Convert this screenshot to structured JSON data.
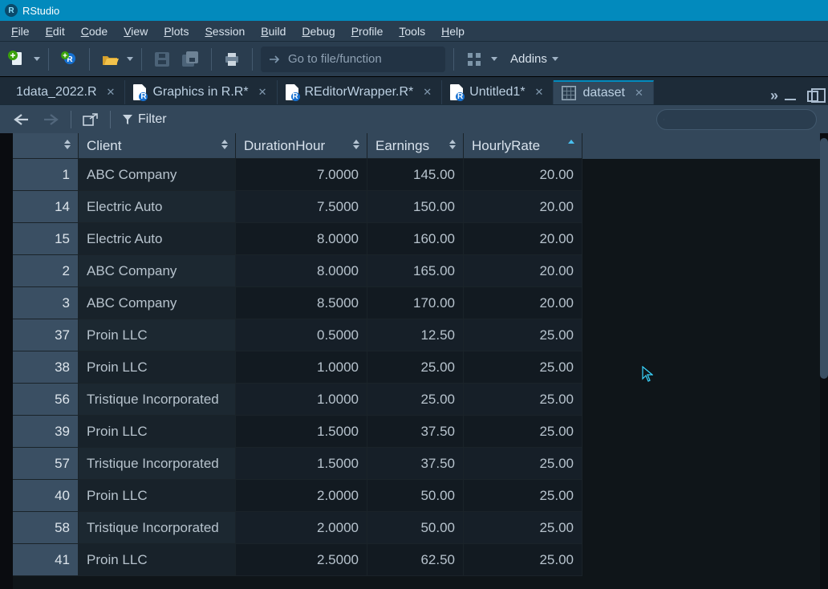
{
  "title": "RStudio",
  "menu": [
    "File",
    "Edit",
    "Code",
    "View",
    "Plots",
    "Session",
    "Build",
    "Debug",
    "Profile",
    "Tools",
    "Help"
  ],
  "goto_placeholder": "Go to file/function",
  "addins_label": "Addins",
  "tabs": [
    {
      "label": "1data_2022.R",
      "icon": "none",
      "dirty": false,
      "active": false
    },
    {
      "label": "Graphics in R.R*",
      "icon": "r",
      "dirty": true,
      "active": false
    },
    {
      "label": "REditorWrapper.R*",
      "icon": "r",
      "dirty": true,
      "active": false
    },
    {
      "label": "Untitled1*",
      "icon": "r",
      "dirty": true,
      "active": false
    },
    {
      "label": "dataset",
      "icon": "grid",
      "dirty": false,
      "active": true
    }
  ],
  "filter_label": "Filter",
  "search_placeholder": "",
  "columns": [
    {
      "key": "idx",
      "label": "",
      "sort": "both"
    },
    {
      "key": "Client",
      "label": "Client",
      "sort": "both"
    },
    {
      "key": "DurationHour",
      "label": "DurationHour",
      "sort": "both"
    },
    {
      "key": "Earnings",
      "label": "Earnings",
      "sort": "both"
    },
    {
      "key": "HourlyRate",
      "label": "HourlyRate",
      "sort": "asc"
    }
  ],
  "rows": [
    {
      "idx": "1",
      "Client": "ABC Company",
      "DurationHour": "7.0000",
      "Earnings": "145.00",
      "HourlyRate": "20.00"
    },
    {
      "idx": "14",
      "Client": "Electric Auto",
      "DurationHour": "7.5000",
      "Earnings": "150.00",
      "HourlyRate": "20.00"
    },
    {
      "idx": "15",
      "Client": "Electric Auto",
      "DurationHour": "8.0000",
      "Earnings": "160.00",
      "HourlyRate": "20.00"
    },
    {
      "idx": "2",
      "Client": "ABC Company",
      "DurationHour": "8.0000",
      "Earnings": "165.00",
      "HourlyRate": "20.00"
    },
    {
      "idx": "3",
      "Client": "ABC Company",
      "DurationHour": "8.5000",
      "Earnings": "170.00",
      "HourlyRate": "20.00"
    },
    {
      "idx": "37",
      "Client": "Proin LLC",
      "DurationHour": "0.5000",
      "Earnings": "12.50",
      "HourlyRate": "25.00"
    },
    {
      "idx": "38",
      "Client": "Proin LLC",
      "DurationHour": "1.0000",
      "Earnings": "25.00",
      "HourlyRate": "25.00"
    },
    {
      "idx": "56",
      "Client": "Tristique Incorporated",
      "DurationHour": "1.0000",
      "Earnings": "25.00",
      "HourlyRate": "25.00"
    },
    {
      "idx": "39",
      "Client": "Proin LLC",
      "DurationHour": "1.5000",
      "Earnings": "37.50",
      "HourlyRate": "25.00"
    },
    {
      "idx": "57",
      "Client": "Tristique Incorporated",
      "DurationHour": "1.5000",
      "Earnings": "37.50",
      "HourlyRate": "25.00"
    },
    {
      "idx": "40",
      "Client": "Proin LLC",
      "DurationHour": "2.0000",
      "Earnings": "50.00",
      "HourlyRate": "25.00"
    },
    {
      "idx": "58",
      "Client": "Tristique Incorporated",
      "DurationHour": "2.0000",
      "Earnings": "50.00",
      "HourlyRate": "25.00"
    },
    {
      "idx": "41",
      "Client": "Proin LLC",
      "DurationHour": "2.5000",
      "Earnings": "62.50",
      "HourlyRate": "25.00"
    }
  ]
}
